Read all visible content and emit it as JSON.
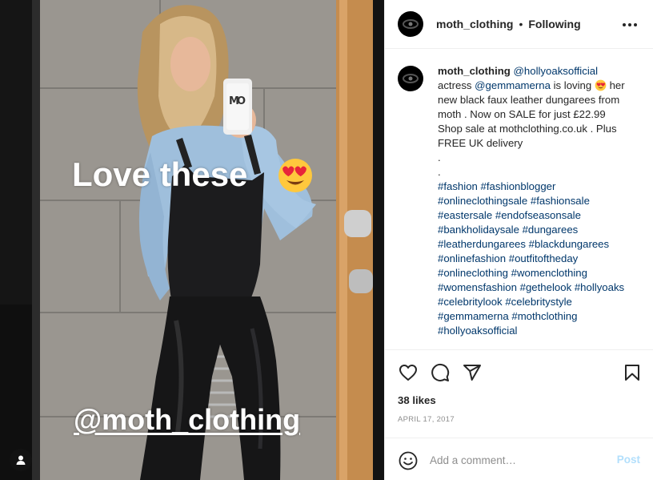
{
  "photo": {
    "overlay_text_1": "Love these",
    "overlay_emoji": "heart-eyes-emoji",
    "overlay_text_2": "@moth_clothing",
    "tag_button_icon": "person-tag-icon"
  },
  "header": {
    "username": "moth_clothing",
    "separator": "•",
    "follow_status": "Following",
    "more_icon": "more-options-icon"
  },
  "caption": {
    "username": "moth_clothing",
    "lines": [
      {
        "segments": [
          {
            "text": "@hollyoaksofficial",
            "link": true
          }
        ]
      },
      {
        "segments": [
          {
            "text": "actress "
          },
          {
            "text": "@gemmamerna",
            "link": true
          },
          {
            "text": " is loving "
          },
          {
            "emoji": "heart-eyes-emoji"
          },
          {
            "text": " her"
          }
        ]
      },
      {
        "segments": [
          {
            "text": "new black faux leather dungarees from"
          }
        ]
      },
      {
        "segments": [
          {
            "text": "moth . Now on SALE for just £22.99"
          }
        ]
      },
      {
        "segments": [
          {
            "text": "Shop sale at mothclothing.co.uk . Plus"
          }
        ]
      },
      {
        "segments": [
          {
            "text": "FREE UK delivery"
          }
        ]
      },
      {
        "segments": [
          {
            "text": "."
          }
        ]
      },
      {
        "segments": [
          {
            "text": "."
          }
        ]
      },
      {
        "segments": [
          {
            "text": "#fashion",
            "link": true
          },
          {
            "text": " "
          },
          {
            "text": "#fashionblogger",
            "link": true
          }
        ]
      },
      {
        "segments": [
          {
            "text": "#onlineclothingsale",
            "link": true
          },
          {
            "text": " "
          },
          {
            "text": "#fashionsale",
            "link": true
          }
        ]
      },
      {
        "segments": [
          {
            "text": "#eastersale",
            "link": true
          },
          {
            "text": " "
          },
          {
            "text": "#endofseasonsale",
            "link": true
          }
        ]
      },
      {
        "segments": [
          {
            "text": "#bankholidaysale",
            "link": true
          },
          {
            "text": " "
          },
          {
            "text": "#dungarees",
            "link": true
          }
        ]
      },
      {
        "segments": [
          {
            "text": "#leatherdungarees",
            "link": true
          },
          {
            "text": " "
          },
          {
            "text": "#blackdungarees",
            "link": true
          }
        ]
      },
      {
        "segments": [
          {
            "text": "#onlinefashion",
            "link": true
          },
          {
            "text": " "
          },
          {
            "text": "#outfitoftheday",
            "link": true
          }
        ]
      },
      {
        "segments": [
          {
            "text": "#onlineclothing",
            "link": true
          },
          {
            "text": " "
          },
          {
            "text": "#womenclothing",
            "link": true
          }
        ]
      },
      {
        "segments": [
          {
            "text": "#womensfashion",
            "link": true
          },
          {
            "text": " "
          },
          {
            "text": "#gethelook",
            "link": true
          },
          {
            "text": " "
          },
          {
            "text": "#hollyoaks",
            "link": true
          }
        ]
      },
      {
        "segments": [
          {
            "text": "#celebritylook",
            "link": true
          },
          {
            "text": " "
          },
          {
            "text": "#celebritystyle",
            "link": true
          }
        ]
      },
      {
        "segments": [
          {
            "text": "#gemmamerna",
            "link": true
          },
          {
            "text": " "
          },
          {
            "text": "#mothclothing",
            "link": true
          }
        ]
      },
      {
        "segments": [
          {
            "text": "#hollyoaksofficial",
            "link": true
          }
        ]
      }
    ]
  },
  "actions": {
    "like_icon": "heart-icon",
    "comment_icon": "comment-icon",
    "share_icon": "share-icon",
    "save_icon": "bookmark-icon"
  },
  "likes_text": "38 likes",
  "date_text": "APRIL 17, 2017",
  "comment_box": {
    "emoji_icon": "emoji-icon",
    "placeholder": "Add a comment…",
    "post_label": "Post"
  },
  "colors": {
    "text": "#262626",
    "link": "#00376b",
    "muted": "#8e8e8e",
    "post_disabled": "#b2dffc",
    "divider": "#efefef"
  }
}
